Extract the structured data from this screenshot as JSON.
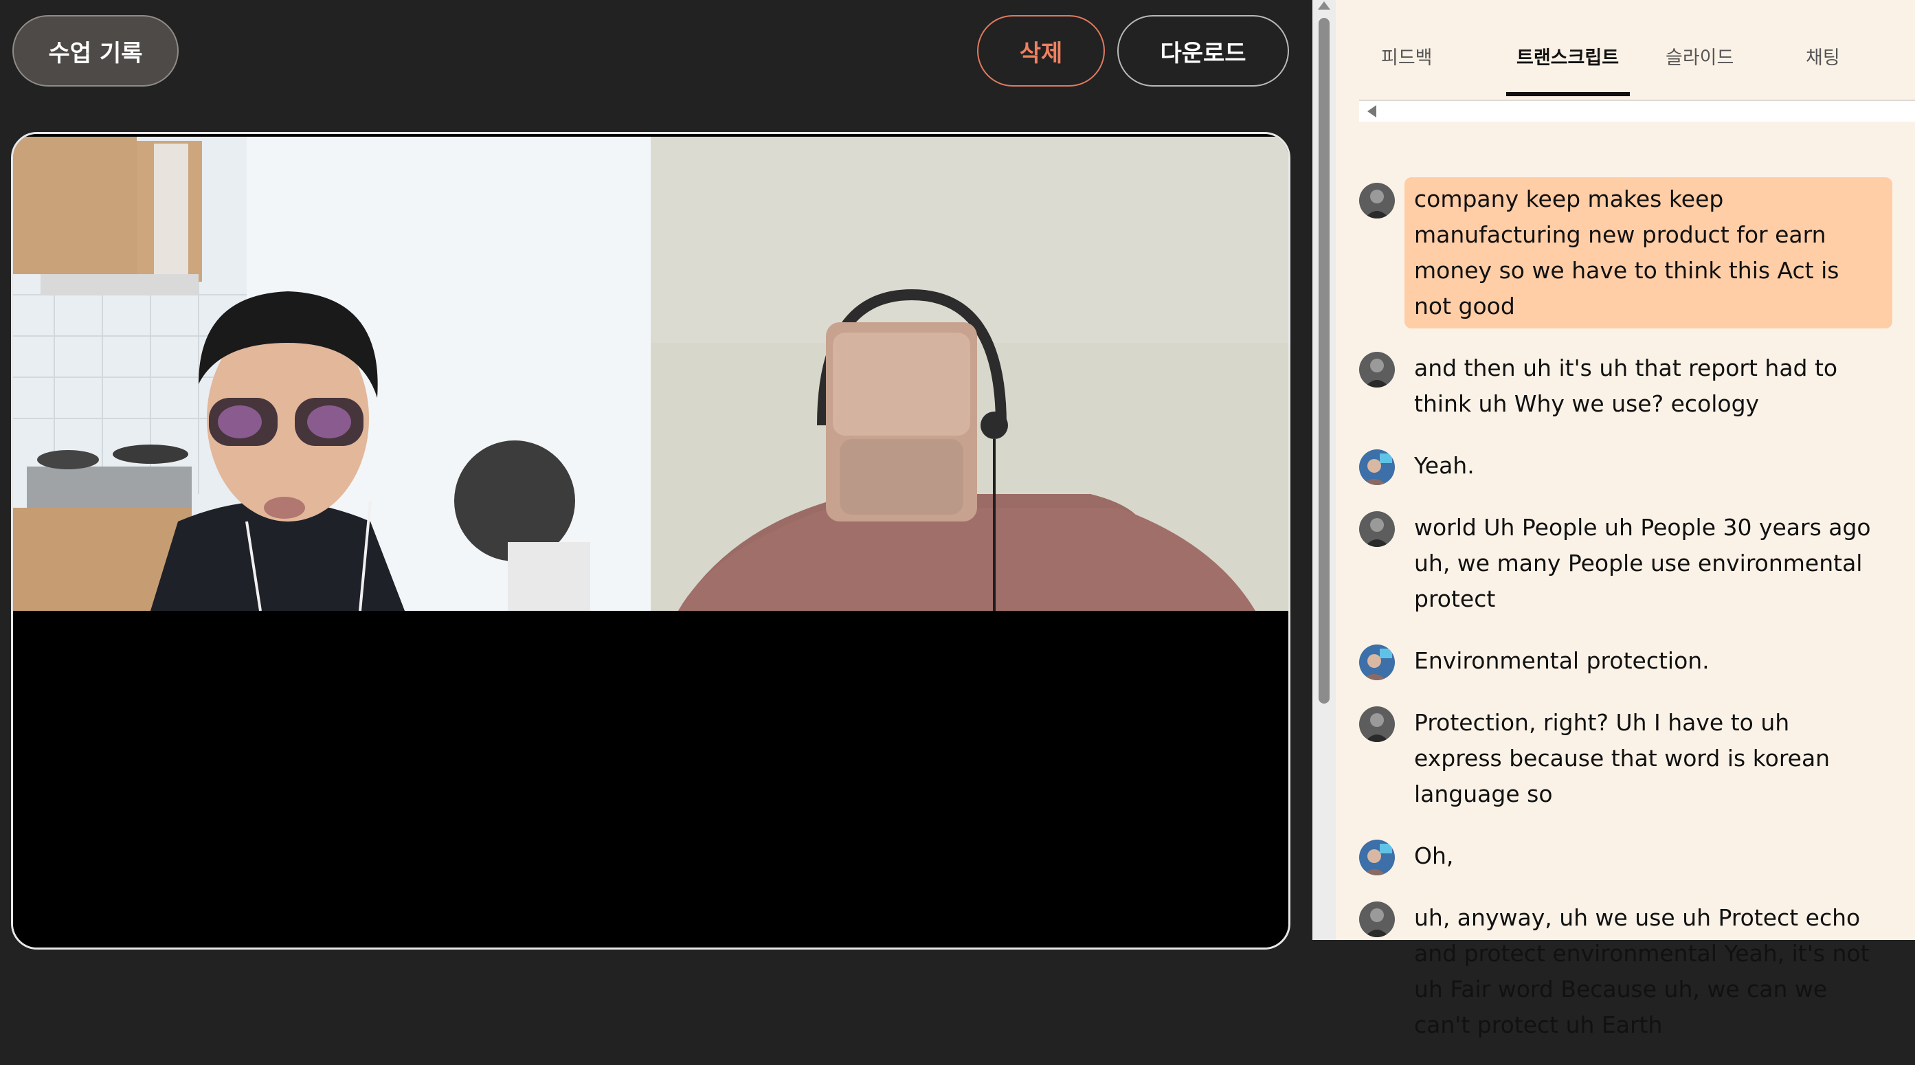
{
  "header": {
    "history_button": "수업 기록",
    "delete_button": "삭제",
    "download_button": "다운로드"
  },
  "tabs": [
    {
      "label": "피드백",
      "active": false
    },
    {
      "label": "트랜스크립트",
      "active": true
    },
    {
      "label": "슬라이드",
      "active": false
    },
    {
      "label": "채팅",
      "active": false
    }
  ],
  "transcript": [
    {
      "speaker": "student",
      "text": "company keep makes keep manufacturing new product for earn money so we have to think this Act is not good",
      "highlighted": true
    },
    {
      "speaker": "student",
      "text": "and then uh it's uh that report had to think uh Why we use? ecology",
      "highlighted": false
    },
    {
      "speaker": "tutor",
      "text": "Yeah.",
      "highlighted": false
    },
    {
      "speaker": "student",
      "text": "world Uh People uh People 30 years ago uh, we many People use environmental protect",
      "highlighted": false
    },
    {
      "speaker": "tutor",
      "text": "Environmental protection.",
      "highlighted": false
    },
    {
      "speaker": "student",
      "text": "Protection, right? Uh I have to uh express because that word is korean language so",
      "highlighted": false
    },
    {
      "speaker": "tutor",
      "text": "Oh,",
      "highlighted": false
    },
    {
      "speaker": "student",
      "text": "uh, anyway, uh we use uh Protect echo and protect environmental Yeah, it's not uh Fair word Because uh, we can we can't protect uh Earth",
      "highlighted": false
    }
  ],
  "colors": {
    "highlight": "#ffcda6",
    "delete_accent": "#f08060",
    "panel_background": "#fbf2e7"
  }
}
